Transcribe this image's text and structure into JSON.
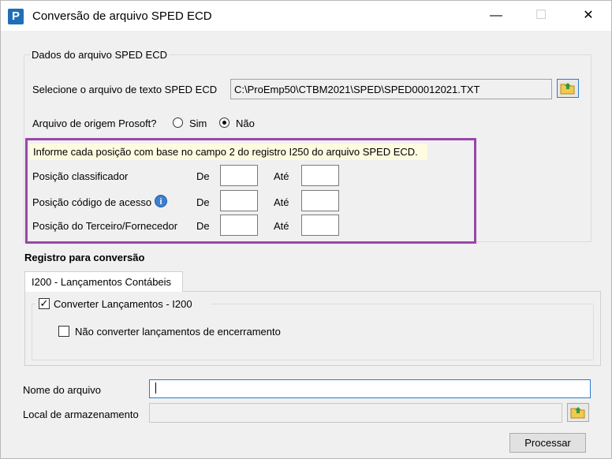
{
  "window": {
    "title": "Conversão de arquivo SPED ECD",
    "app_icon_letter": "P"
  },
  "dados": {
    "legend": "Dados do arquivo SPED ECD",
    "select_label": "Selecione o arquivo de texto SPED ECD",
    "file_path": "C:\\ProEmp50\\CTBM2021\\SPED\\SPED00012021.TXT",
    "origem_label": "Arquivo de origem Prosoft?",
    "sim_label": "Sim",
    "nao_label": "Não",
    "origem_selected": "Não",
    "note": "Informe cada posição com base no campo 2 do registro I250 do arquivo SPED ECD.",
    "de_label": "De",
    "ate_label": "Até",
    "rows": [
      {
        "label": "Posição classificador",
        "de": "",
        "ate": ""
      },
      {
        "label": "Posição código de acesso",
        "de": "",
        "ate": ""
      },
      {
        "label": "Posição do Terceiro/Fornecedor",
        "de": "",
        "ate": ""
      }
    ]
  },
  "registro": {
    "heading": "Registro para conversão",
    "tab_label": "I200 - Lançamentos Contábeis",
    "converter_label": "Converter Lançamentos - I200",
    "converter_checked": true,
    "nao_converter_label": "Não converter lançamentos de encerramento",
    "nao_converter_checked": false
  },
  "bottom": {
    "nome_label": "Nome do arquivo",
    "nome_value": "",
    "local_label": "Local de armazenamento",
    "local_value": "",
    "process_button": "Processar"
  }
}
